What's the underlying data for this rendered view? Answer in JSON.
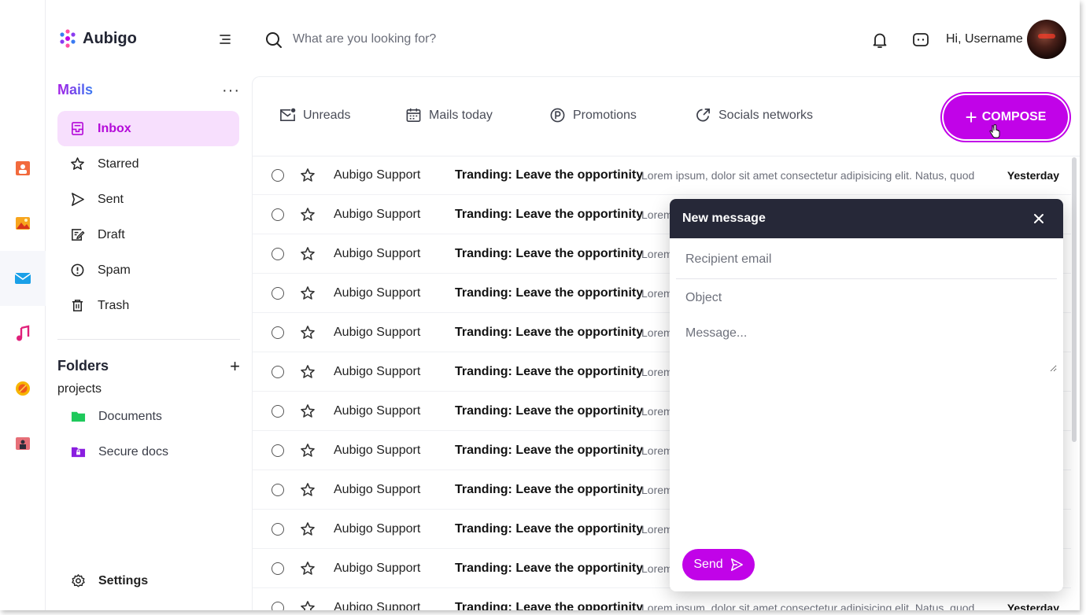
{
  "brand": {
    "name": "Aubigo"
  },
  "search": {
    "placeholder": "What are you looking for?"
  },
  "user": {
    "greeting": "Hi, Username"
  },
  "mails_section": {
    "title": "Mails",
    "items": [
      {
        "label": "Inbox",
        "icon": "inbox-icon",
        "active": true
      },
      {
        "label": "Starred",
        "icon": "star-icon"
      },
      {
        "label": "Sent",
        "icon": "send-icon"
      },
      {
        "label": "Draft",
        "icon": "draft-icon"
      },
      {
        "label": "Spam",
        "icon": "spam-icon"
      },
      {
        "label": "Trash",
        "icon": "trash-icon"
      }
    ]
  },
  "folders_section": {
    "title": "Folders",
    "group": "projects",
    "items": [
      {
        "label": "Documents",
        "icon": "folder-icon",
        "color": "#1ec95b"
      },
      {
        "label": "Secure docs",
        "icon": "locked-folder-icon",
        "color": "#8a1ee0"
      }
    ]
  },
  "settings": {
    "label": "Settings"
  },
  "tabs": [
    {
      "label": "Unreads",
      "icon": "unread-mail-icon"
    },
    {
      "label": "Mails today",
      "icon": "calendar-icon"
    },
    {
      "label": "Promotions",
      "icon": "promotion-icon"
    },
    {
      "label": "Socials networks",
      "icon": "external-link-icon"
    }
  ],
  "compose": {
    "label": "COMPOSE"
  },
  "mails": [
    {
      "sender": "Aubigo Support",
      "subject": "Tranding: Leave the opportinity",
      "preview": "Lorem ipsum, dolor sit amet consectetur adipisicing elit. Natus, quod",
      "date": "Yesterday"
    },
    {
      "sender": "Aubigo Support",
      "subject": "Tranding: Leave the opportinity",
      "preview": "Lorem",
      "date": ""
    },
    {
      "sender": "Aubigo Support",
      "subject": "Tranding: Leave the opportinity",
      "preview": "Lorem",
      "date": ""
    },
    {
      "sender": "Aubigo Support",
      "subject": "Tranding: Leave the opportinity",
      "preview": "Lorem",
      "date": ""
    },
    {
      "sender": "Aubigo Support",
      "subject": "Tranding: Leave the opportinity",
      "preview": "Lorem",
      "date": ""
    },
    {
      "sender": "Aubigo Support",
      "subject": "Tranding: Leave the opportinity",
      "preview": "Lorem",
      "date": ""
    },
    {
      "sender": "Aubigo Support",
      "subject": "Tranding: Leave the opportinity",
      "preview": "Lorem",
      "date": ""
    },
    {
      "sender": "Aubigo Support",
      "subject": "Tranding: Leave the opportinity",
      "preview": "Lorem",
      "date": ""
    },
    {
      "sender": "Aubigo Support",
      "subject": "Tranding: Leave the opportinity",
      "preview": "Lorem",
      "date": ""
    },
    {
      "sender": "Aubigo Support",
      "subject": "Tranding: Leave the opportinity",
      "preview": "Lorem",
      "date": ""
    },
    {
      "sender": "Aubigo Support",
      "subject": "Tranding: Leave the opportinity",
      "preview": "Lorem",
      "date": ""
    },
    {
      "sender": "Aubigo Support",
      "subject": "Tranding: Leave the opportinity",
      "preview": "Lorem ipsum, dolor sit amet consectetur adipisicing elit. Natus, quod",
      "date": "Yesterday"
    }
  ],
  "new_message": {
    "title": "New message",
    "recipient_placeholder": "Recipient email",
    "object_placeholder": "Object",
    "message_placeholder": "Message...",
    "send_label": "Send"
  },
  "colors": {
    "accent": "#c103e8",
    "active_bg": "#f7dffd",
    "popup_header": "#262838"
  }
}
